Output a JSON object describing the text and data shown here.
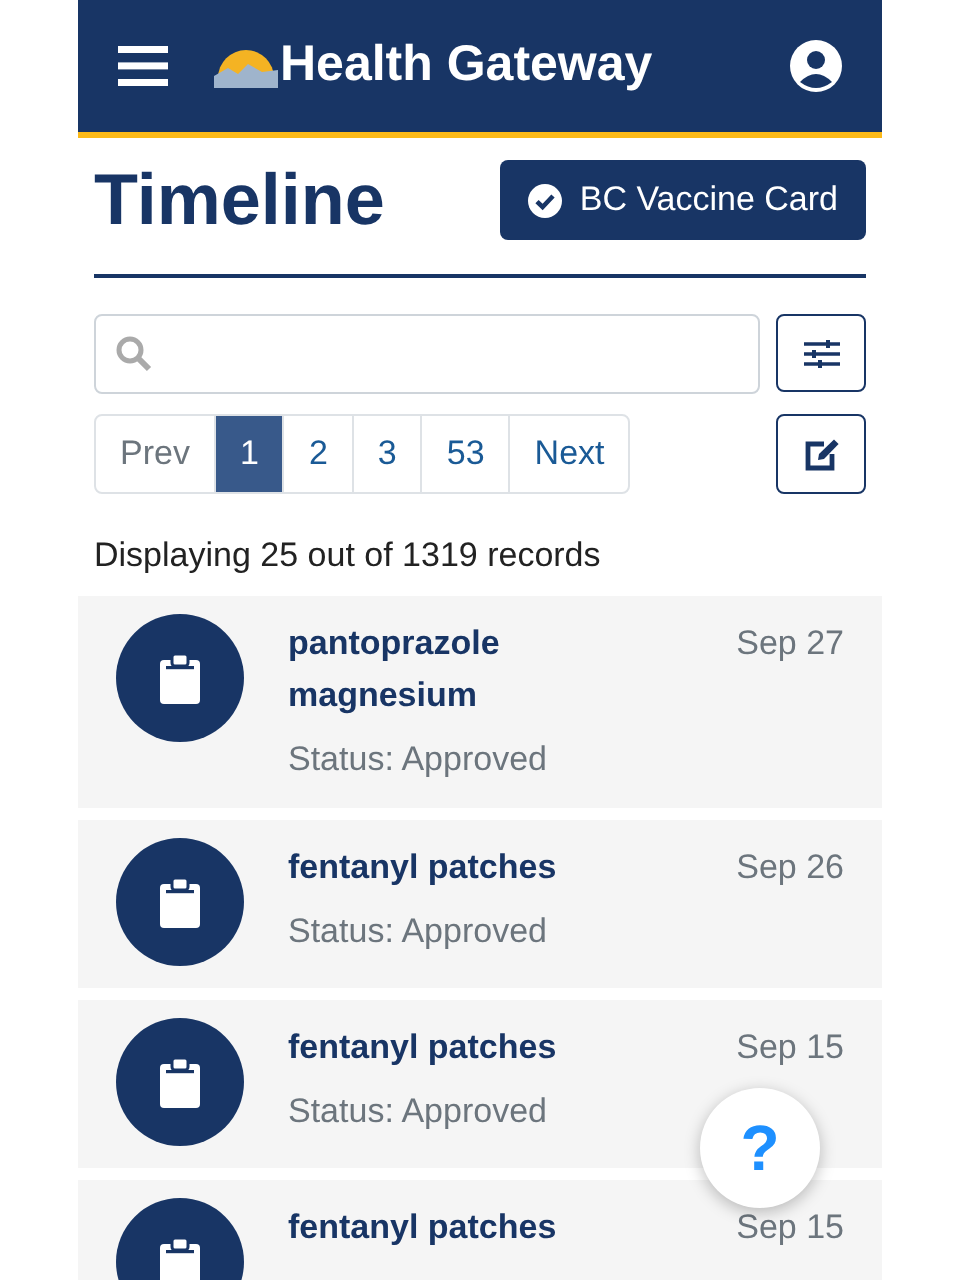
{
  "header": {
    "title": "Health Gateway"
  },
  "page": {
    "title": "Timeline",
    "vaccine_button": "BC Vaccine Card"
  },
  "pagination": [
    {
      "label": "Prev",
      "selected": false
    },
    {
      "label": "1",
      "selected": true
    },
    {
      "label": "2",
      "selected": false
    },
    {
      "label": "3",
      "selected": false
    },
    {
      "label": "53",
      "selected": false
    },
    {
      "label": "Next",
      "selected": false
    }
  ],
  "summary": "Displaying 25 out of 1319 records",
  "entries": [
    {
      "title": "pantoprazole magnesium",
      "status": "Status: Approved",
      "date": "Sep 27"
    },
    {
      "title": "fentanyl patches",
      "status": "Status: Approved",
      "date": "Sep 26"
    },
    {
      "title": "fentanyl patches",
      "status": "Status: Approved",
      "date": "Sep 15"
    },
    {
      "title": "fentanyl patches",
      "date": "Sep 15"
    }
  ],
  "help_button": "?"
}
